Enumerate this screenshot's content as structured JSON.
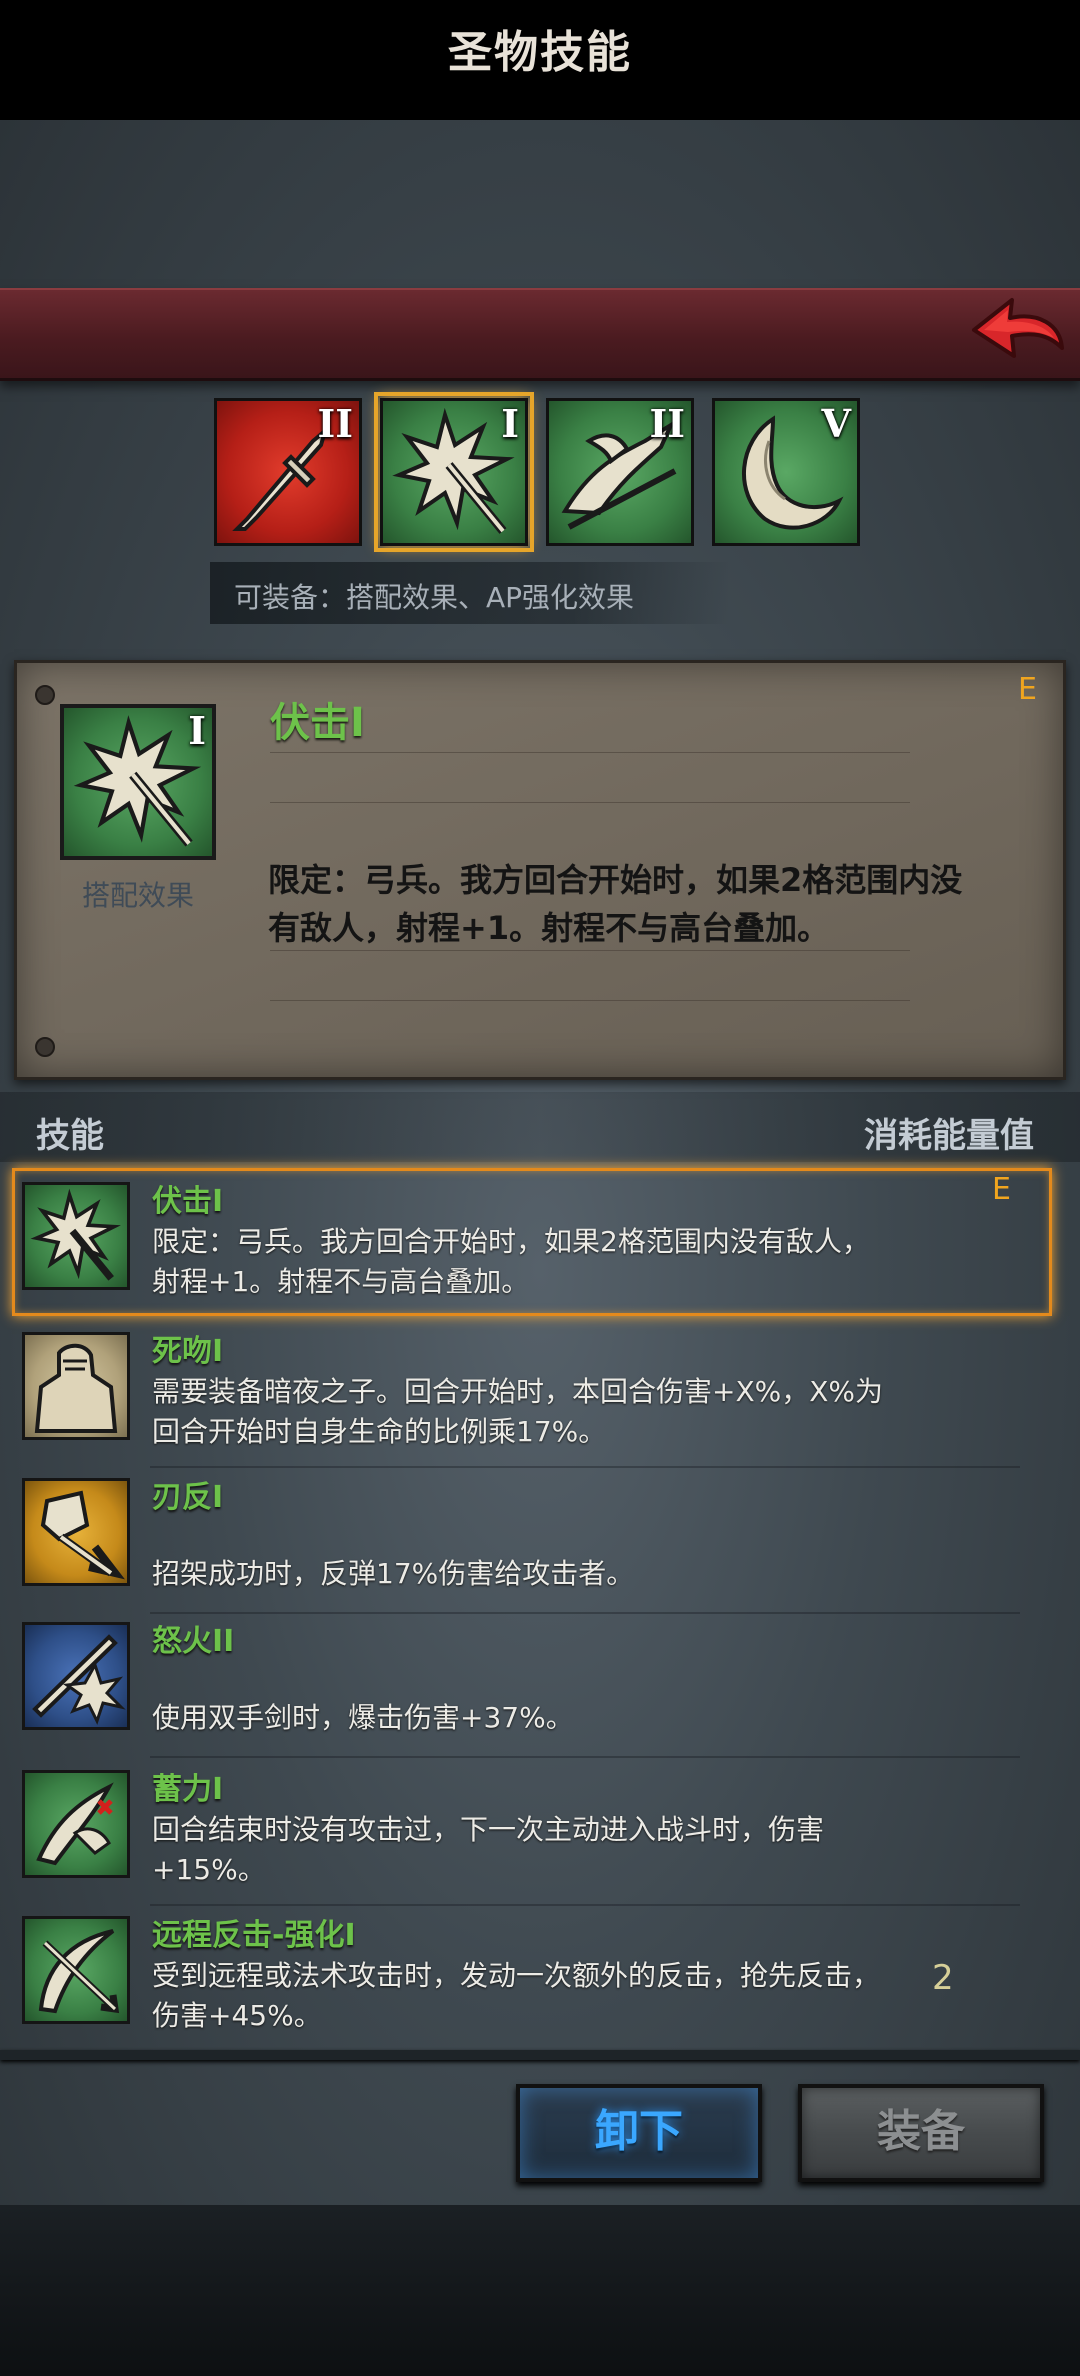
{
  "header": {
    "title": "圣物技能",
    "back_icon": "back-arrow-icon"
  },
  "relics": [
    {
      "grade": "II",
      "icon": "sword-icon",
      "bg": "#c3271f"
    },
    {
      "grade": "I",
      "icon": "spiked-arrow-icon",
      "bg": "#3f8f4a",
      "selected": true
    },
    {
      "grade": "II",
      "icon": "eagle-slash-icon",
      "bg": "#3f8f4a"
    },
    {
      "grade": "V",
      "icon": "horn-icon",
      "bg": "#3f8f4a"
    }
  ],
  "equip_hint": "可装备：搭配效果、AP强化效果",
  "detail": {
    "name": "伏击I",
    "grade": "E",
    "icon_grade": "I",
    "icon_label": "搭配效果",
    "desc": "限定：弓兵。我方回合开始时，如果2格范围内没有敌人，射程+1。射程不与高台叠加。"
  },
  "skills_header": {
    "left": "技能",
    "right": "消耗能量值"
  },
  "skills": [
    {
      "name": "伏击I",
      "desc": "限定：弓兵。我方回合开始时，如果2格范围内没有敌人，射程+1。射程不与高台叠加。",
      "grade": "E",
      "cost": "",
      "icon": "spiked-arrow-icon",
      "bg": "#3f8f4a"
    },
    {
      "name": "死吻I",
      "desc": "需要装备暗夜之子。回合开始时，本回合伤害+X%，X%为回合开始时自身生命的比例乘17%。",
      "grade": "",
      "cost": "",
      "icon": "armored-knight-icon",
      "bg": "#b8aa80"
    },
    {
      "name": "刃反I",
      "desc": "招架成功时，反弹17%伤害给攻击者。",
      "grade": "",
      "cost": "",
      "icon": "shield-parry-icon",
      "bg": "#c8911b"
    },
    {
      "name": "怒火II",
      "desc": "使用双手剑时，爆击伤害+37%。",
      "grade": "",
      "cost": "",
      "icon": "fury-sword-icon",
      "bg": "#2e4f88"
    },
    {
      "name": "蓄力I",
      "desc": "回合结束时没有攻击过，下一次主动进入战斗时，伤害+15%。",
      "grade": "",
      "cost": "",
      "icon": "charge-bird-icon",
      "bg": "#3f8f4a"
    },
    {
      "name": "远程反击-强化I",
      "desc": "受到远程或法术攻击时，发动一次额外的反击，抢先反击，伤害+45%。",
      "grade": "",
      "cost": "2",
      "icon": "bow-counter-icon",
      "bg": "#3f8f4a"
    }
  ],
  "buttons": {
    "unequip": "卸下",
    "equip": "装备"
  }
}
